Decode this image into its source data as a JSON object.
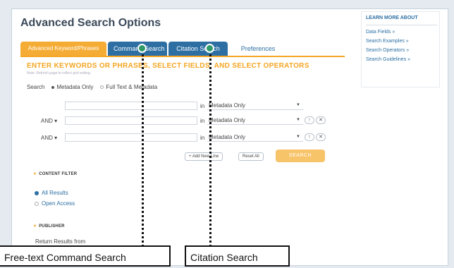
{
  "page": {
    "title": "Advanced Search Options",
    "tabs": [
      {
        "label": "Advanced Keyword/Phrases"
      },
      {
        "label": "Command Search"
      },
      {
        "label": "Citation Search"
      },
      {
        "label": "Preferences"
      }
    ],
    "heading": "ENTER KEYWORDS OR PHRASES, SELECT FIELDS, AND SELECT OPERATORS",
    "note": "Note: Refresh page to reflect grid setting."
  },
  "search_scope": {
    "label": "Search",
    "options": [
      {
        "label": "Metadata Only",
        "selected": true
      },
      {
        "label": "Full Text & Metadata",
        "selected": false
      }
    ]
  },
  "rows": [
    {
      "operator": "",
      "keyword": "",
      "in_label": "in",
      "field": "Metadata Only"
    },
    {
      "operator": "AND ▾",
      "keyword": "",
      "in_label": "in",
      "field": "Metadata Only"
    },
    {
      "operator": "AND ▾",
      "keyword": "",
      "in_label": "in",
      "field": "Metadata Only"
    }
  ],
  "buttons": {
    "add_new_line": "+ Add New Line",
    "reset_all": "Reset All",
    "search": "SEARCH",
    "row_up": "↑",
    "row_remove": "✕"
  },
  "content_filter": {
    "title": "CONTENT FILTER",
    "options": [
      {
        "label": "All Results",
        "selected": true
      },
      {
        "label": "Open Access",
        "selected": false
      }
    ]
  },
  "publisher": {
    "title": "PUBLISHER",
    "return_text": "Return Results from"
  },
  "sidebar": {
    "title": "LEARN MORE ABOUT",
    "links": [
      {
        "label": "Data Fields »"
      },
      {
        "label": "Search Examples »"
      },
      {
        "label": "Search Operators »"
      },
      {
        "label": "Search Guidelines »"
      }
    ]
  },
  "callouts": {
    "command": "Free-text Command Search",
    "citation": "Citation Search"
  },
  "colors": {
    "accent": "#f5a623",
    "tab_blue": "#2d6fa3",
    "pointer_green": "#2e9a6a"
  }
}
